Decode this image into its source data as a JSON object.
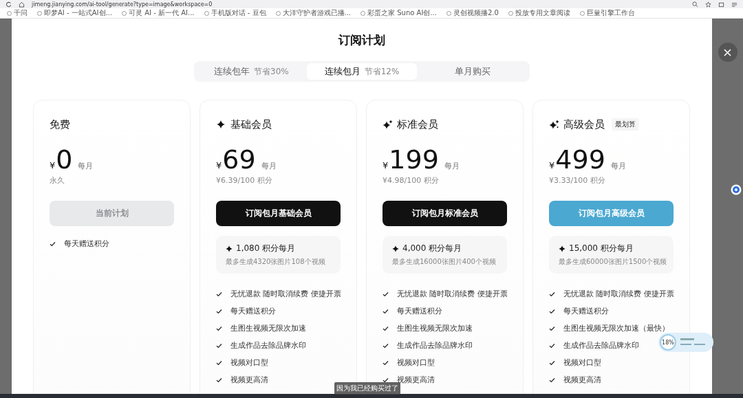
{
  "browser": {
    "url": "jimeng.jianying.com/ai-tool/generate?type=image&workspace=0",
    "bookmarks": [
      "千问",
      "即梦AI - 一站式AI创...",
      "可灵 AI - 新一代 AI...",
      "手机版对话 - 豆包",
      "大洋守护者游戏已播...",
      "彩蛋之家 Suno AI创...",
      "灵创视频播2.0",
      "投放专用文章阅读",
      "巨量引擎工作台"
    ]
  },
  "dialog": {
    "title": "订阅计划",
    "tabs": [
      {
        "label": "连续包年",
        "note": "节省30%",
        "selected": false
      },
      {
        "label": "连续包月",
        "note": "节省12%",
        "selected": true
      },
      {
        "label": "单月购买",
        "selected": false
      }
    ],
    "plans": [
      {
        "kind": "free",
        "name": "免费",
        "currency": "¥",
        "price": "0",
        "period": "每月",
        "unit_price": "永久",
        "button": {
          "label": "当前计划",
          "disabled": true,
          "highlighted": false
        },
        "features": [
          "每天赠送积分"
        ]
      },
      {
        "kind": "basic",
        "name": "基础会员",
        "currency": "¥",
        "price": "69",
        "period": "每月",
        "unit_price": "¥6.39/100 积分",
        "button": {
          "label": "订阅包月基础会员",
          "disabled": false,
          "highlighted": false
        },
        "credits": {
          "amount": "1,080 积分每月",
          "detail": "最多生成4320张图片108个视频"
        },
        "features": [
          "无忧退款 随时取消续费 便捷开票",
          "每天赠送积分",
          "生图生视频无限次加速",
          "生成作品去除品牌水印",
          "视频对口型",
          "视频更高清"
        ]
      },
      {
        "kind": "standard",
        "name": "标准会员",
        "currency": "¥",
        "price": "199",
        "period": "每月",
        "unit_price": "¥4.98/100 积分",
        "button": {
          "label": "订阅包月标准会员",
          "disabled": false,
          "highlighted": false
        },
        "credits": {
          "amount": "4,000 积分每月",
          "detail": "最多生成16000张图片400个视频"
        },
        "features": [
          "无忧退款 随时取消续费 便捷开票",
          "每天赠送积分",
          "生图生视频无限次加速",
          "生成作品去除品牌水印",
          "视频对口型",
          "视频更高清"
        ]
      },
      {
        "kind": "premium",
        "name": "高级会员",
        "badge": "最划算",
        "currency": "¥",
        "price": "499",
        "period": "每月",
        "unit_price": "¥3.33/100 积分",
        "button": {
          "label": "订阅包月高级会员",
          "disabled": false,
          "highlighted": true
        },
        "credits": {
          "amount": "15,000 积分每月",
          "detail": "最多生成60000张图片1500个视频"
        },
        "features": [
          "无忧退款 随时取消续费 便捷开票",
          "每天赠送积分",
          "生图生视频无限次加速（最快）",
          "生成作品去除品牌水印",
          "视频对口型",
          "视频更高清"
        ]
      }
    ]
  },
  "speed_widget": {
    "percent": "18%"
  },
  "caption": "因为我已经购买过了"
}
